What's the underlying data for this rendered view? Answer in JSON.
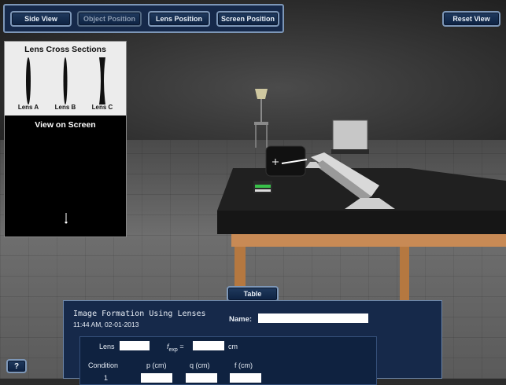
{
  "toolbar": {
    "side_view": "Side View",
    "object_position": "Object Position",
    "lens_position": "Lens Position",
    "screen_position": "Screen Position",
    "reset_view": "Reset View"
  },
  "cross_sections": {
    "title": "Lens Cross Sections",
    "lenses": [
      "Lens A",
      "Lens B",
      "Lens C"
    ]
  },
  "screen": {
    "title": "View on Screen"
  },
  "table_tab": {
    "label": "Table"
  },
  "worksheet": {
    "title": "Image Formation Using Lenses",
    "timestamp": "11:44 AM, 02-01-2013",
    "name_label": "Name:",
    "name_value": "",
    "lens_label": "Lens",
    "lens_value": "",
    "fexp_label_f": "f",
    "fexp_label_sub": "exp",
    "fexp_label_eq": " =",
    "fexp_value": "",
    "fexp_unit": "cm",
    "columns": [
      "Condition",
      "p (cm)",
      "q (cm)",
      "f (cm)"
    ],
    "rows": [
      {
        "condition": "1",
        "p": "",
        "q": "",
        "f": ""
      }
    ]
  },
  "help_button": {
    "label": "?"
  }
}
